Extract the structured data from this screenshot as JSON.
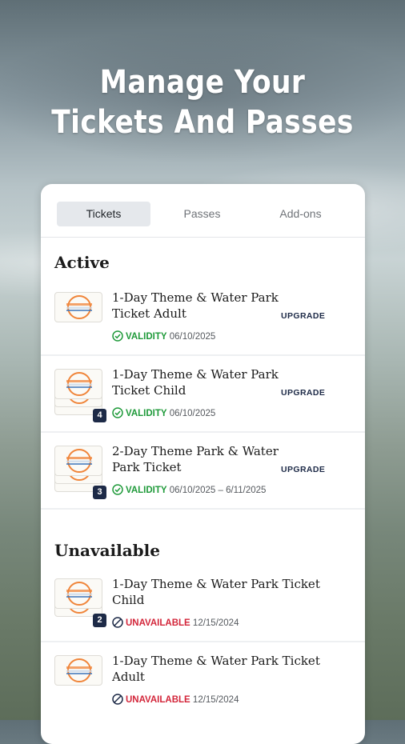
{
  "headline": {
    "line1": "Manage Your",
    "line2": "Tickets And Passes"
  },
  "tabs": [
    {
      "label": "Tickets",
      "active": true
    },
    {
      "label": "Passes",
      "active": false
    },
    {
      "label": "Add-ons",
      "active": false
    }
  ],
  "sections": {
    "active": "Active",
    "unavailable": "Unavailable"
  },
  "active_tickets": [
    {
      "line1": "1-Day Theme & Water Park",
      "line2": "Ticket Adult",
      "status": "VALIDITY",
      "date": "06/10/2025",
      "action": "UPGRADE",
      "count": ""
    },
    {
      "line1": "1-Day Theme & Water Park",
      "line2": "Ticket Child",
      "status": "VALIDITY",
      "date": "06/10/2025",
      "action": "UPGRADE",
      "count": "4"
    },
    {
      "line1": "2-Day Theme Park & Water",
      "line2": "Park Ticket",
      "status": "VALIDITY",
      "date": "06/10/2025 – 6/11/2025",
      "action": "UPGRADE",
      "count": "3"
    }
  ],
  "unavailable_tickets": [
    {
      "line1": "1-Day Theme & Water Park Ticket",
      "line2": "Child",
      "status": "UNAVAILABLE",
      "date": "12/15/2024",
      "count": "2"
    },
    {
      "line1": "1-Day Theme & Water Park Ticket",
      "line2": "Adult",
      "status": "UNAVAILABLE",
      "date": "12/15/2024",
      "count": ""
    }
  ],
  "colors": {
    "valid": "#1f9a3a",
    "unavailable": "#d3263a",
    "navy": "#1d2a47",
    "ticket_ring": "#f0853a"
  },
  "icons": {
    "valid": "check-circle-icon",
    "unavailable": "ban-circle-icon"
  }
}
